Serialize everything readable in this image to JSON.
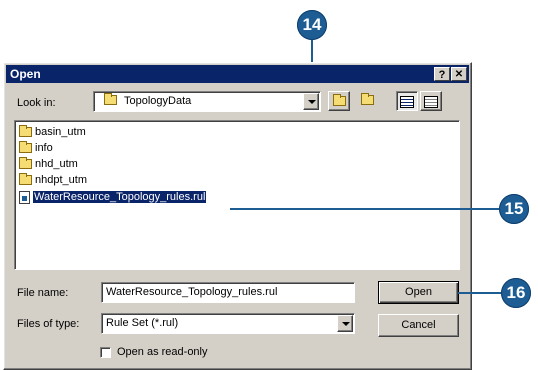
{
  "dialog": {
    "title": "Open",
    "help_button": "?",
    "close_button": "✕"
  },
  "look_in": {
    "label": "Look in:",
    "value": "TopologyData"
  },
  "files": [
    {
      "name": "basin_utm",
      "type": "folder"
    },
    {
      "name": "info",
      "type": "folder"
    },
    {
      "name": "nhd_utm",
      "type": "folder"
    },
    {
      "name": "nhdpt_utm",
      "type": "folder"
    },
    {
      "name": "WaterResource_Topology_rules.rul",
      "type": "file",
      "selected": true
    }
  ],
  "file_name": {
    "label": "File name:",
    "value": "WaterResource_Topology_rules.rul"
  },
  "files_of_type": {
    "label": "Files of type:",
    "value": "Rule Set (*.rul)"
  },
  "buttons": {
    "open": "Open",
    "cancel": "Cancel"
  },
  "read_only": {
    "label": "Open as read-only",
    "checked": false
  },
  "callouts": [
    "14",
    "15",
    "16"
  ],
  "colors": {
    "callout": "#1e5c94",
    "titlebar": "#0a246a",
    "dialog_face": "#d4d0c8"
  }
}
